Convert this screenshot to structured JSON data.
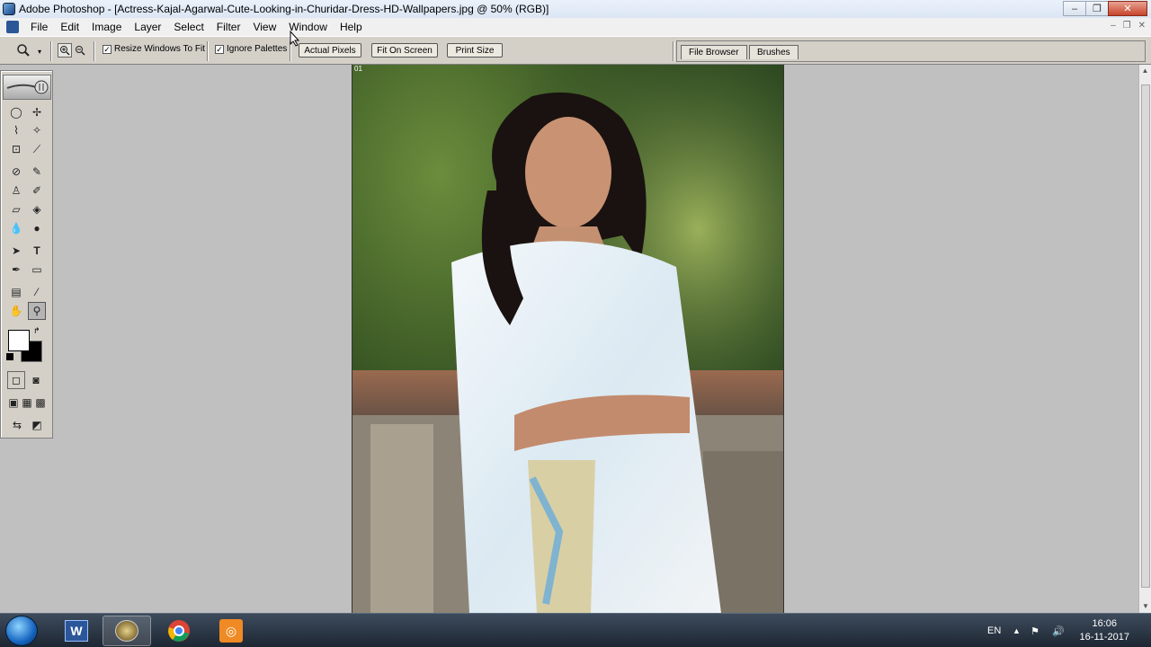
{
  "window": {
    "title": "Adobe Photoshop - [Actress-Kajal-Agarwal-Cute-Looking-in-Churidar-Dress-HD-Wallpapers.jpg @ 50% (RGB)]",
    "minimize": "‒",
    "maximize": "❐",
    "close": "✕"
  },
  "menubar": {
    "items": [
      "File",
      "Edit",
      "Image",
      "Layer",
      "Select",
      "Filter",
      "View",
      "Window",
      "Help"
    ],
    "mdi": [
      "‒",
      "❐",
      "✕"
    ]
  },
  "options": {
    "resize_windows_label": "Resize Windows To Fit",
    "resize_windows_checked": "✓",
    "ignore_palettes_label": "Ignore Palettes",
    "ignore_palettes_checked": "✓",
    "actual_pixels": "Actual Pixels",
    "fit_on_screen": "Fit On Screen",
    "print_size": "Print Size"
  },
  "palette_well": {
    "tabs": [
      "File Browser",
      "Brushes"
    ]
  },
  "document": {
    "corner_label": "01"
  },
  "taskbar": {
    "language": "EN",
    "time": "16:06",
    "date": "16-11-2017",
    "apps": [
      "word-icon",
      "photoshop-icon",
      "chrome-icon",
      "vlc-icon"
    ]
  },
  "colors": {
    "foreground": "#ffffff",
    "background": "#000000"
  }
}
